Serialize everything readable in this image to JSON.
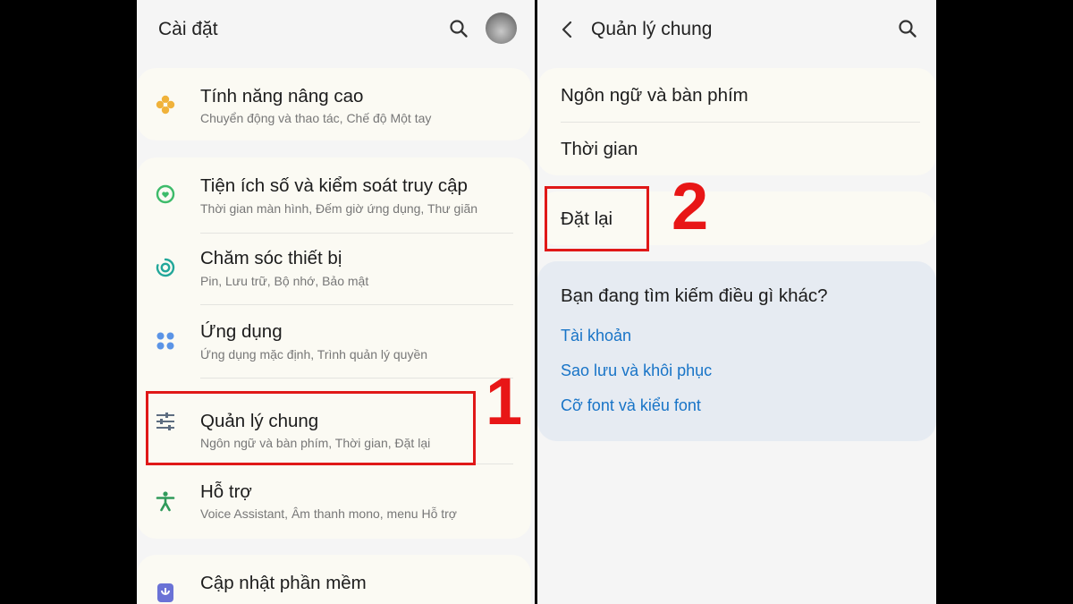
{
  "left_screen": {
    "title": "Cài đặt",
    "items": [
      {
        "title": "Tính năng nâng cao",
        "subtitle": "Chuyển động và thao tác, Chế độ Một tay"
      },
      {
        "title": "Tiện ích số và kiểm soát truy cập",
        "subtitle": "Thời gian màn hình, Đếm giờ ứng dụng, Thư giãn"
      },
      {
        "title": "Chăm sóc thiết bị",
        "subtitle": "Pin, Lưu trữ, Bộ nhớ, Bảo mật"
      },
      {
        "title": "Ứng dụng",
        "subtitle": "Ứng dụng mặc định, Trình quản lý quyền"
      },
      {
        "title": "Quản lý chung",
        "subtitle": "Ngôn ngữ và bàn phím, Thời gian, Đặt lại"
      },
      {
        "title": "Hỗ trợ",
        "subtitle": "Voice Assistant, Âm thanh mono, menu Hỗ trợ"
      },
      {
        "title": "Cập nhật phần mềm",
        "subtitle": ""
      }
    ]
  },
  "right_screen": {
    "title": "Quản lý chung",
    "items": [
      {
        "title": "Ngôn ngữ và bàn phím"
      },
      {
        "title": "Thời gian"
      },
      {
        "title": "Đặt lại"
      }
    ],
    "suggestions": {
      "heading": "Bạn đang tìm kiếm điều gì khác?",
      "links": [
        "Tài khoản",
        "Sao lưu và khôi phục",
        "Cỡ font và kiểu font"
      ]
    }
  },
  "annotations": {
    "step1": "1",
    "step2": "2"
  },
  "colors": {
    "link": "#1874c7",
    "highlight": "#e01818",
    "card": "#fbfaf3",
    "background": "#f5f5f5"
  }
}
